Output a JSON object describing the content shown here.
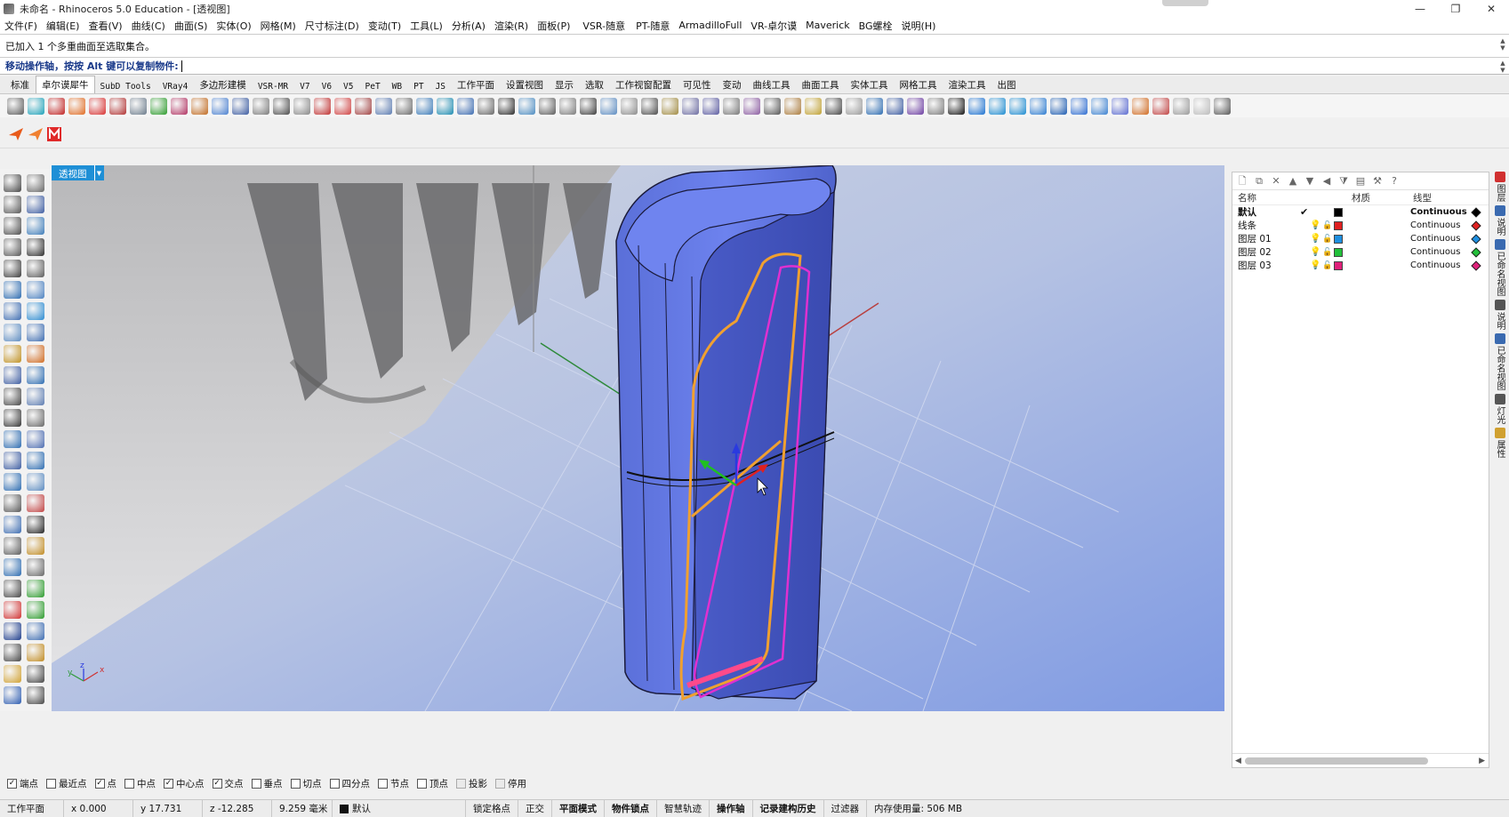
{
  "window": {
    "title": "未命名 - Rhinoceros 5.0 Education - [透视图]",
    "controls": [
      "—",
      "❐",
      "✕"
    ]
  },
  "menu": [
    "文件(F)",
    "编辑(E)",
    "查看(V)",
    "曲线(C)",
    "曲面(S)",
    "实体(O)",
    "网格(M)",
    "尺寸标注(D)",
    "变动(T)",
    "工具(L)",
    "分析(A)",
    "渲染(R)",
    "面板(P)"
  ],
  "plugin_menu": [
    "VSR-随意",
    "PT-随意",
    "ArmadilloFull",
    "VR-卓尔谟",
    "Maverick",
    "BG螺栓",
    "说明(H)"
  ],
  "command": {
    "history": "已加入 1 个多重曲面至选取集合。",
    "prompt": "移动操作轴，按按 Alt 键可以复制物件:"
  },
  "tabs": [
    {
      "label": "标准",
      "mono": false
    },
    {
      "label": "卓尔谟犀牛",
      "mono": false,
      "active": true
    },
    {
      "label": "SubD Tools",
      "mono": true
    },
    {
      "label": "VRay4",
      "mono": true
    },
    {
      "label": "多边形建模",
      "mono": false
    },
    {
      "label": "VSR-MR",
      "mono": true
    },
    {
      "label": "V7",
      "mono": true
    },
    {
      "label": "V6",
      "mono": true
    },
    {
      "label": "V5",
      "mono": true
    },
    {
      "label": "PeT",
      "mono": true
    },
    {
      "label": "WB",
      "mono": true
    },
    {
      "label": "PT",
      "mono": true
    },
    {
      "label": "JS",
      "mono": true
    },
    {
      "label": "工作平面",
      "mono": false
    },
    {
      "label": "设置视图",
      "mono": false
    },
    {
      "label": "显示",
      "mono": false
    },
    {
      "label": "选取",
      "mono": false
    },
    {
      "label": "工作视窗配置",
      "mono": false
    },
    {
      "label": "可见性",
      "mono": false
    },
    {
      "label": "变动",
      "mono": false
    },
    {
      "label": "曲线工具",
      "mono": false
    },
    {
      "label": "曲面工具",
      "mono": false
    },
    {
      "label": "实体工具",
      "mono": false
    },
    {
      "label": "网格工具",
      "mono": false
    },
    {
      "label": "渲染工具",
      "mono": false
    },
    {
      "label": "出图",
      "mono": false
    }
  ],
  "viewport": {
    "label": "透视图",
    "axis_x": "x",
    "axis_y": "y",
    "axis_z": "z"
  },
  "layers": {
    "headers": {
      "name": "名称",
      "material": "材质",
      "linetype": "线型"
    },
    "rows": [
      {
        "name": "默认",
        "current": "✔",
        "color": "#000000",
        "linetype": "Continuous",
        "bold": true
      },
      {
        "name": "线条",
        "current": "",
        "color": "#e02020",
        "linetype": "Continuous",
        "bold": false
      },
      {
        "name": "图层 01",
        "current": "",
        "color": "#1e8fe0",
        "linetype": "Continuous",
        "bold": false
      },
      {
        "name": "图层 02",
        "current": "",
        "color": "#22c03a",
        "linetype": "Continuous",
        "bold": false
      },
      {
        "name": "图层 03",
        "current": "",
        "color": "#e0207a",
        "linetype": "Continuous",
        "bold": false
      }
    ]
  },
  "side_tabs": [
    "图层",
    "说明",
    "已命名视图",
    "说明",
    "已命名视图",
    "灯光",
    "属性"
  ],
  "osnaps": [
    {
      "label": "端点",
      "checked": true
    },
    {
      "label": "最近点",
      "checked": false
    },
    {
      "label": "点",
      "checked": true
    },
    {
      "label": "中点",
      "checked": false
    },
    {
      "label": "中心点",
      "checked": true
    },
    {
      "label": "交点",
      "checked": true
    },
    {
      "label": "垂点",
      "checked": false
    },
    {
      "label": "切点",
      "checked": false
    },
    {
      "label": "四分点",
      "checked": false
    },
    {
      "label": "节点",
      "checked": false
    },
    {
      "label": "顶点",
      "checked": false
    },
    {
      "label": "投影",
      "checked": false,
      "disabled": true
    },
    {
      "label": "停用",
      "checked": false,
      "disabled": true
    }
  ],
  "status": {
    "cplane": "工作平面",
    "x": "x 0.000",
    "y": "y 17.731",
    "z": "z -12.285",
    "distance": "9.259 毫米",
    "layer": "默认",
    "grid_snap": "锁定格点",
    "ortho": "正交",
    "planar": "平面模式",
    "osnap": "物件锁点",
    "smarttrack": "智慧轨迹",
    "gumball": "操作轴",
    "history": "记录建构历史",
    "filter": "过滤器",
    "memory": "内存使用量: 506 MB"
  }
}
